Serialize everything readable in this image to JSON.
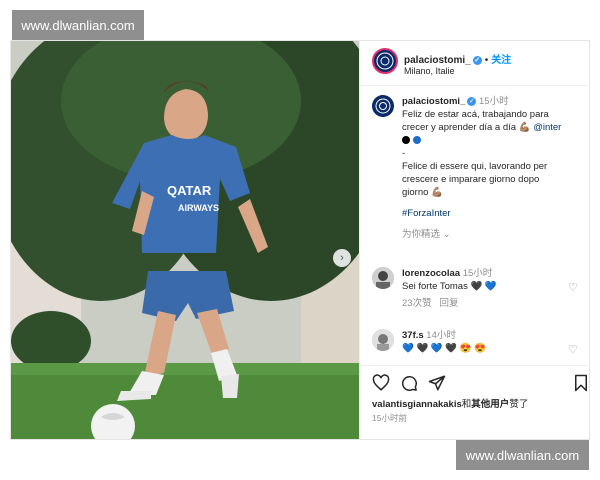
{
  "watermark": {
    "top": "www.dlwanlian.com",
    "bottom": "www.dlwanlian.com"
  },
  "post": {
    "username": "palaciostomi_",
    "follow_label": "关注",
    "location": "Milano, Italie",
    "caption": {
      "username": "palaciostomi_",
      "time": "15小时",
      "line1": "Feliz de estar acá, trabajando para",
      "line2": "crecer y aprender día a día 💪🏽",
      "mention": "@inter",
      "dash": "-",
      "it_line1": "Felice di essere qui, lavorando per",
      "it_line2": "crescere e imparare giorno dopo",
      "it_line3": "giorno 💪🏽",
      "hashtag": "#ForzaInter",
      "translate": "为你精选"
    },
    "comments": [
      {
        "username": "lorenzocolaa",
        "time": "15小时",
        "text": "Sei forte Tomas 🖤 💙",
        "likes": "23次赞",
        "reply": "回复"
      },
      {
        "username": "37f.s",
        "time": "14小时",
        "text": "💙 🖤 💙 🖤 😍 😍"
      }
    ],
    "likes_text": {
      "user": "valantisgiannakakis",
      "and": "和",
      "others": "其他用户",
      "suffix": "赞了"
    },
    "post_time": "15小时前",
    "photo": {
      "jersey_text1": "QATAR",
      "jersey_text2": "AIRWAYS"
    }
  },
  "colors": {
    "accent": "#0095f6",
    "link": "#00376b",
    "muted": "#8e8e8e",
    "jersey": "#3d6fb4"
  }
}
